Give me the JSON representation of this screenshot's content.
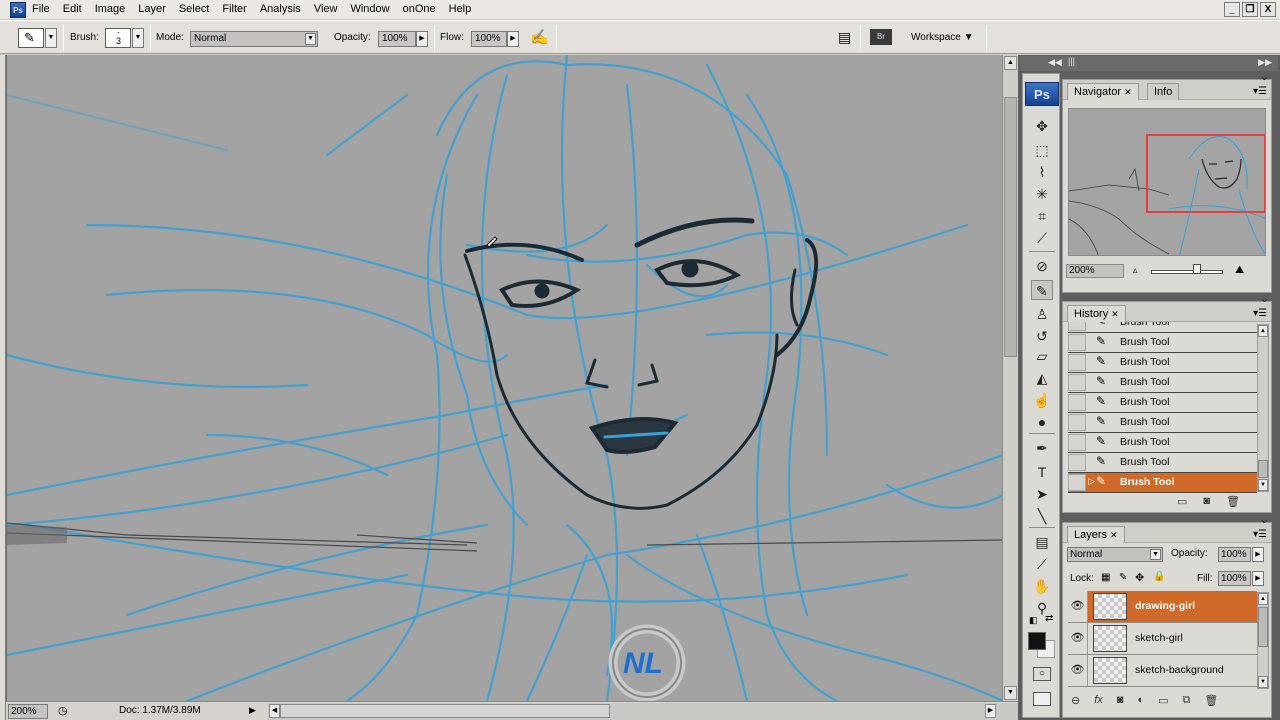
{
  "app": {
    "icon_label": "Ps"
  },
  "menu": [
    "File",
    "Edit",
    "Image",
    "Layer",
    "Select",
    "Filter",
    "Analysis",
    "View",
    "Window",
    "onOne",
    "Help"
  ],
  "window_controls": {
    "minimize": "_",
    "restore": "❐",
    "close": "X"
  },
  "options_bar": {
    "brush_label": "Brush:",
    "brush_size": "3",
    "mode_label": "Mode:",
    "mode_value": "Normal",
    "opacity_label": "Opacity:",
    "opacity_value": "100%",
    "flow_label": "Flow:",
    "flow_value": "100%",
    "workspace_label": "Workspace ▼"
  },
  "status_bar": {
    "zoom": "200%",
    "doc": "Doc: 1.37M/3.89M"
  },
  "toolbox": {
    "logo": "Ps",
    "tools": [
      {
        "name": "move-tool-icon",
        "glyph": "✥"
      },
      {
        "name": "marquee-tool-icon",
        "glyph": "⬚"
      },
      {
        "name": "lasso-tool-icon",
        "glyph": "⌇"
      },
      {
        "name": "magic-wand-tool-icon",
        "glyph": "✳"
      },
      {
        "name": "crop-tool-icon",
        "glyph": "⌗"
      },
      {
        "name": "slice-tool-icon",
        "glyph": "⟋"
      },
      {
        "name": "healing-brush-tool-icon",
        "glyph": "⊘"
      },
      {
        "name": "brush-tool-icon",
        "glyph": "✎"
      },
      {
        "name": "clone-stamp-tool-icon",
        "glyph": "♙"
      },
      {
        "name": "history-brush-tool-icon",
        "glyph": "↺"
      },
      {
        "name": "eraser-tool-icon",
        "glyph": "▱"
      },
      {
        "name": "paint-bucket-tool-icon",
        "glyph": "◭"
      },
      {
        "name": "smudge-tool-icon",
        "glyph": "☝"
      },
      {
        "name": "dodge-tool-icon",
        "glyph": "●"
      },
      {
        "name": "pen-tool-icon",
        "glyph": "✒"
      },
      {
        "name": "type-tool-icon",
        "glyph": "T"
      },
      {
        "name": "path-selection-tool-icon",
        "glyph": "➤"
      },
      {
        "name": "line-tool-icon",
        "glyph": "╲"
      },
      {
        "name": "notes-tool-icon",
        "glyph": "▤"
      },
      {
        "name": "eyedropper-tool-icon",
        "glyph": "⟋"
      },
      {
        "name": "hand-tool-icon",
        "glyph": "✋"
      },
      {
        "name": "zoom-tool-icon",
        "glyph": "⚲"
      }
    ]
  },
  "navigator": {
    "tabs": [
      "Navigator",
      "Info"
    ],
    "zoom": "200%"
  },
  "history": {
    "tab": "History",
    "items": [
      "Brush Tool",
      "Brush Tool",
      "Brush Tool",
      "Brush Tool",
      "Brush Tool",
      "Brush Tool",
      "Brush Tool",
      "Brush Tool",
      "Brush Tool"
    ],
    "active_index": 8
  },
  "layers": {
    "tab": "Layers",
    "blend_mode": "Normal",
    "opacity_label": "Opacity:",
    "opacity_value": "100%",
    "lock_label": "Lock:",
    "fill_label": "Fill:",
    "fill_value": "100%",
    "items": [
      {
        "name": "drawing-girl",
        "active": true
      },
      {
        "name": "sketch-girl",
        "active": false
      },
      {
        "name": "sketch-background",
        "active": false
      }
    ]
  },
  "colors": {
    "accent_selection": "#d06a28",
    "sketch_blue": "#3aa0d4",
    "canvas_bg": "#a3a3a3",
    "navigator_rect": "#e04040"
  }
}
